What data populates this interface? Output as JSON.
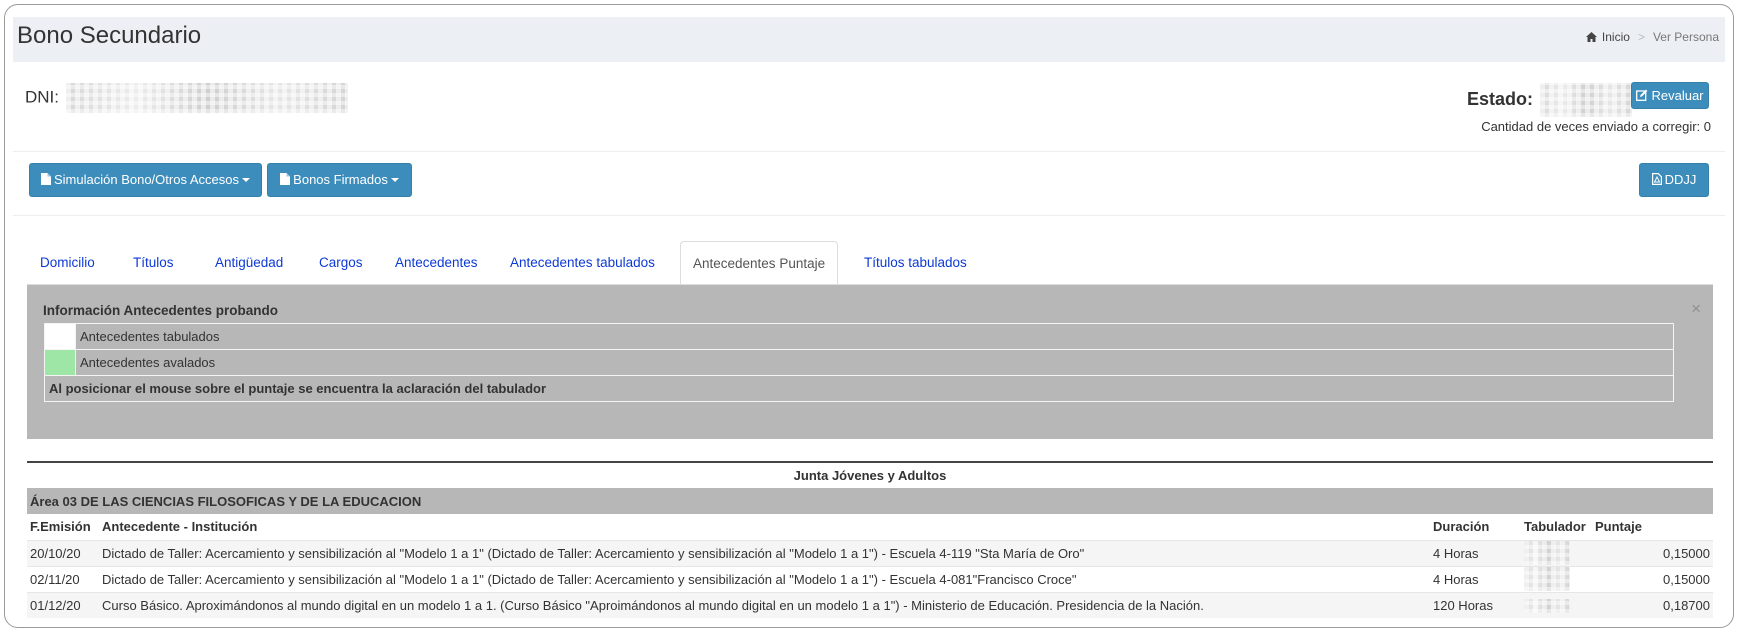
{
  "header": {
    "title": "Bono Secundario",
    "breadcrumb": {
      "home": "Inicio",
      "current": "Ver Persona"
    }
  },
  "persona": {
    "dni_label": "DNI:",
    "estado_label": "Estado:",
    "revaluar_label": "Revaluar",
    "corregir_text": "Cantidad de veces enviado a corregir: 0"
  },
  "toolbar": {
    "simulacion_label": "Simulación Bono/Otros Accesos",
    "bonos_firmados_label": "Bonos Firmados",
    "ddjj_label": "DDJJ"
  },
  "tabs": [
    {
      "label": "Domicilio"
    },
    {
      "label": "Títulos"
    },
    {
      "label": "Antigüedad"
    },
    {
      "label": "Cargos"
    },
    {
      "label": "Antecedentes"
    },
    {
      "label": "Antecedentes tabulados"
    },
    {
      "label": "Antecedentes Puntaje"
    },
    {
      "label": "Títulos tabulados"
    }
  ],
  "active_tab": "Antecedentes Puntaje",
  "info": {
    "title": "Información Antecedentes probando",
    "close": "×",
    "legend": [
      {
        "color": "#ffffff",
        "label": "Antecedentes tabulados"
      },
      {
        "color": "#9ee6a6",
        "label": "Antecedentes avalados"
      }
    ],
    "note": "Al posicionar el mouse sobre el puntaje se encuentra la aclaración del tabulador"
  },
  "table": {
    "junta": "Junta Jóvenes y Adultos",
    "area": "Área 03 DE LAS CIENCIAS FILOSOFICAS Y DE LA EDUCACION",
    "columns": [
      "F.Emisión",
      "Antecedente - Institución",
      "Duración",
      "Tabulador",
      "Puntaje"
    ],
    "rows": [
      {
        "fecha": "20/10/20",
        "antecedente": "Dictado de Taller: Acercamiento y sensibilización al \"Modelo 1 a 1\" (Dictado de Taller: Acercamiento y sensibilización al \"Modelo 1 a 1\") - Escuela 4-119 \"Sta María de Oro\"",
        "duracion": "4 Horas",
        "puntaje": "0,15000"
      },
      {
        "fecha": "02/11/20",
        "antecedente": "Dictado de Taller: Acercamiento y sensibilización al \"Modelo 1 a 1\" (Dictado de Taller: Acercamiento y sensibilización al \"Modelo 1 a 1\") - Escuela 4-081\"Francisco Croce\"",
        "duracion": "4 Horas",
        "puntaje": "0,15000"
      },
      {
        "fecha": "01/12/20",
        "antecedente": "Curso Básico. Aproximándonos al mundo digital en un modelo 1 a 1. (Curso Básico \"Aproimándonos al mundo digital en un modelo 1 a 1\") - Ministerio de Educación. Presidencia de la Nación.",
        "duracion": "120 Horas",
        "puntaje": "0,18700"
      }
    ]
  },
  "colors": {
    "primary": "#3c8dbc",
    "tab_link": "#0d39d6",
    "info_bg": "#b7b7b7",
    "avalado": "#9ee6a6"
  }
}
